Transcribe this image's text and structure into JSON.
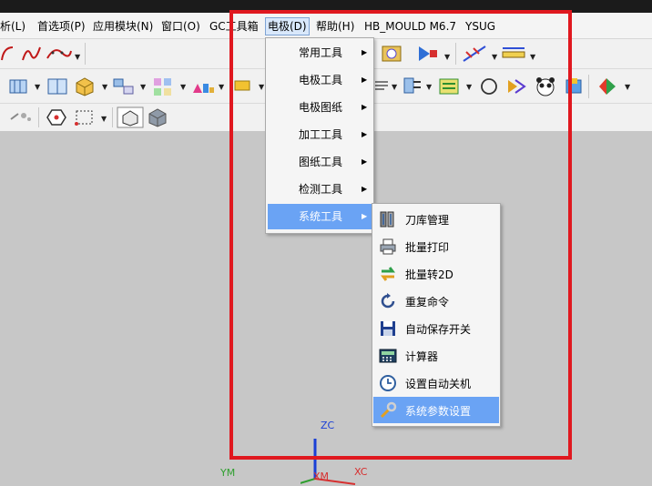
{
  "menubar": {
    "items": [
      {
        "label": "析(L)"
      },
      {
        "label": "首选项(P)"
      },
      {
        "label": "应用模块(N)"
      },
      {
        "label": "窗口(O)"
      },
      {
        "label": "GC工具箱"
      },
      {
        "label": "电极(D)"
      },
      {
        "label": "帮助(H)"
      },
      {
        "label": "HB_MOULD M6.7"
      },
      {
        "label": "YSUG"
      }
    ]
  },
  "electrode_menu": {
    "items": [
      {
        "label": "常用工具"
      },
      {
        "label": "电极工具"
      },
      {
        "label": "电极图纸"
      },
      {
        "label": "加工工具"
      },
      {
        "label": "图纸工具"
      },
      {
        "label": "检测工具"
      },
      {
        "label": "系统工具"
      }
    ],
    "selected": "系统工具",
    "arrow_glyph": "▶"
  },
  "system_tools_menu": {
    "items": [
      {
        "label": "刀库管理",
        "icon": "tool-library-icon"
      },
      {
        "label": "批量打印",
        "icon": "printer-icon"
      },
      {
        "label": "批量转2D",
        "icon": "convert-2d-icon"
      },
      {
        "label": "重复命令",
        "icon": "repeat-icon"
      },
      {
        "label": "自动保存开关",
        "icon": "save-icon"
      },
      {
        "label": "计算器",
        "icon": "calculator-icon"
      },
      {
        "label": "设置自动关机",
        "icon": "clock-icon"
      },
      {
        "label": "系统参数设置",
        "icon": "wrench-icon"
      }
    ],
    "selected": "系统参数设置"
  },
  "viewport": {
    "axis_labels": {
      "zc": "ZC",
      "ym": "YM",
      "xm": "XM",
      "xc": "XC"
    }
  },
  "colors": {
    "highlight_border": "#e0181f",
    "menu_selection": "#6aa3f4",
    "viewport_bg": "#c7c7c7"
  }
}
